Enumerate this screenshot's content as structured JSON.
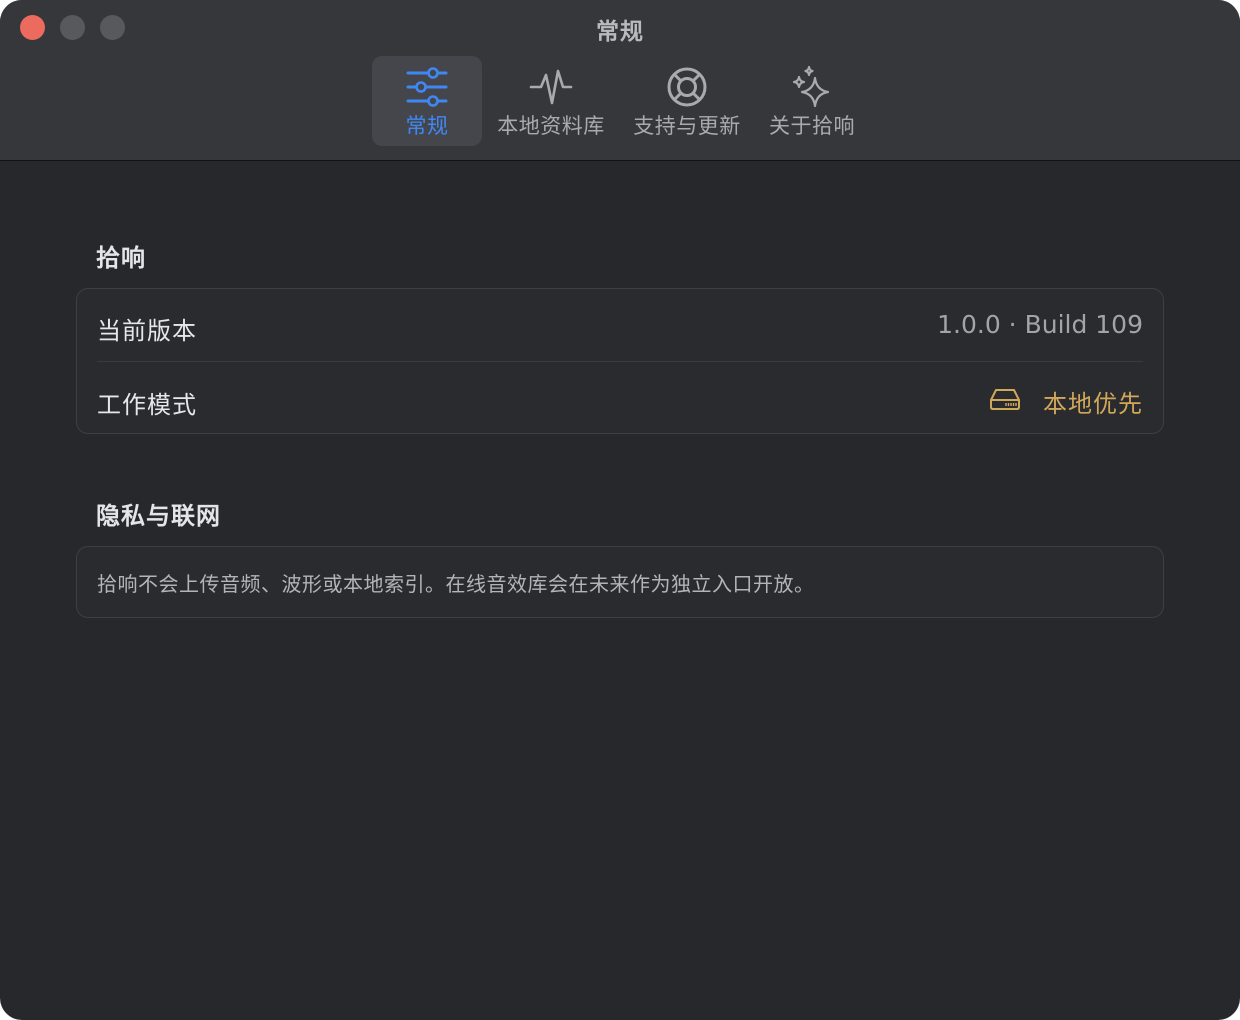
{
  "window": {
    "title": "常规"
  },
  "tabs": [
    {
      "label": "常规",
      "icon": "sliders-icon",
      "active": true
    },
    {
      "label": "本地资料库",
      "icon": "waveform-pulse-icon",
      "active": false
    },
    {
      "label": "支持与更新",
      "icon": "lifebuoy-icon",
      "active": false
    },
    {
      "label": "关于拾响",
      "icon": "sparkles-icon",
      "active": false
    }
  ],
  "app_section": {
    "title": "拾响",
    "rows": {
      "version": {
        "label": "当前版本",
        "value": "1.0.0 · Build 109"
      },
      "mode": {
        "label": "工作模式",
        "value": "本地优先",
        "icon": "internal-drive-icon"
      }
    }
  },
  "privacy_section": {
    "title": "隐私与联网",
    "text": "拾响不会上传音频、波形或本地索引。在线音效库会在未来作为独立入口开放。"
  },
  "colors": {
    "accent": "#3f88f4",
    "mode_accent": "#d1a759",
    "close_button": "#ec6a5e",
    "window_bg": "#27282c",
    "toolbar_bg": "#36373b"
  }
}
